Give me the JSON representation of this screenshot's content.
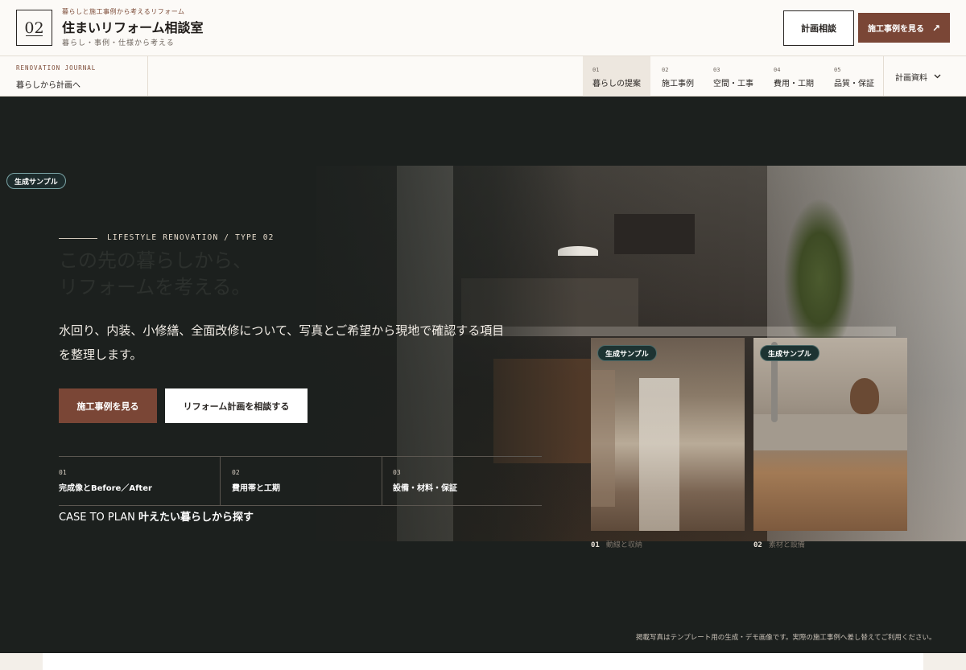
{
  "header": {
    "logo_number": "02",
    "eyebrow": "暮らしと施工事例から考えるリフォーム",
    "title": "住まいリフォーム相談室",
    "subtitle": "暮らし・事例・仕様から考える",
    "consult_label": "計画相談",
    "cases_label": "施工事例を見る",
    "cases_icon": "↗"
  },
  "subnav": {
    "journal_eyebrow": "RENOVATION JOURNAL",
    "journal_title": "暮らしから計画へ",
    "items": [
      {
        "num": "01",
        "label": "暮らしの提案"
      },
      {
        "num": "02",
        "label": "施工事例"
      },
      {
        "num": "03",
        "label": "空間・工事"
      },
      {
        "num": "04",
        "label": "費用・工期"
      },
      {
        "num": "05",
        "label": "品質・保証"
      }
    ],
    "dropdown_label": "計画資料",
    "dropdown_icon": "chevron-down"
  },
  "hero": {
    "badge": "生成サンプル",
    "eyebrow": "LIFESTYLE RENOVATION / TYPE 02",
    "headline_1": "この先の暮らしから、",
    "headline_2": "リフォームを考える。",
    "lead": "水回り、内装、小修繕、全面改修について、写真とご希望から現地で確認する項目を整理します。",
    "primary_button": "施工事例を見る",
    "secondary_button": "リフォーム計画を相談する",
    "facts": [
      {
        "num": "01",
        "label": "完成像とBefore／After"
      },
      {
        "num": "02",
        "label": "費用帯と工期"
      },
      {
        "num": "03",
        "label": "設備・材料・保証"
      }
    ],
    "case_plan_prefix": "CASE TO PLAN",
    "case_plan_text": "叶えたい暮らしから探す",
    "cards": [
      {
        "badge": "生成サンプル",
        "num": "01",
        "caption": "動線と収納"
      },
      {
        "badge": "生成サンプル",
        "num": "02",
        "caption": "素材と設備"
      }
    ],
    "note": "掲載写真はテンプレート用の生成・デモ画像です。実際の施工事例へ差し替えてご利用ください。"
  },
  "colors": {
    "accent": "#7a4636",
    "hero_bg": "#1c201e",
    "badge_bg": "#1d3332"
  }
}
